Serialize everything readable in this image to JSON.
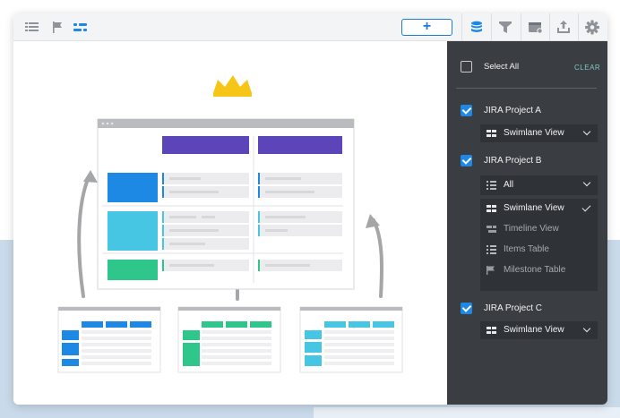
{
  "toolbar": {
    "left_icons": [
      "list-icon",
      "flag-icon",
      "swimlane-icon"
    ],
    "add_button_label": "+",
    "right_icons": [
      "database-icon",
      "filter-icon",
      "card-settings-icon",
      "export-icon",
      "gear-icon"
    ]
  },
  "panel": {
    "select_all_label": "Select All",
    "clear_label": "CLEAR",
    "projects": [
      {
        "name": "JIRA Project A",
        "checked": true,
        "view": "Swimlane View"
      },
      {
        "name": "JIRA Project B",
        "checked": true,
        "view": "All"
      },
      {
        "name": "JIRA Project C",
        "checked": true,
        "view": "Swimlane View"
      }
    ],
    "view_menu": [
      {
        "label": "Swimlane View",
        "icon": "swimlane-icon",
        "selected": true
      },
      {
        "label": "Timeline View",
        "icon": "timeline-icon",
        "selected": false
      },
      {
        "label": "Items Table",
        "icon": "table-icon",
        "selected": false
      },
      {
        "label": "Milestone Table",
        "icon": "flag-icon",
        "selected": false
      }
    ]
  },
  "colors": {
    "accent": "#1e88e5",
    "panel_bg": "#3a3d41",
    "crown": "#f5c518",
    "board_header": "#5c45b8",
    "green": "#2fc68b",
    "teal": "#47c6e3"
  }
}
